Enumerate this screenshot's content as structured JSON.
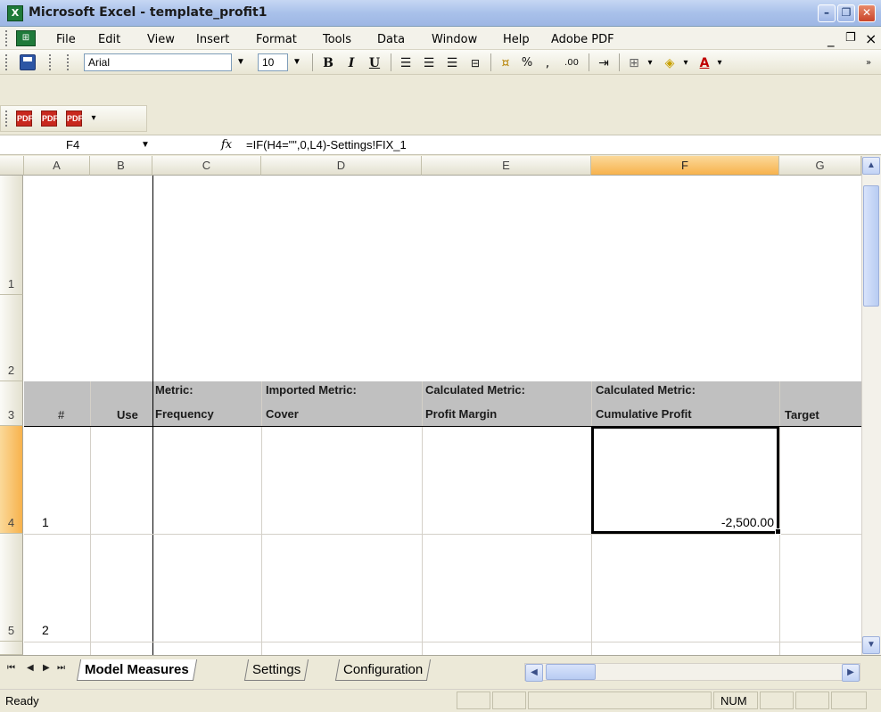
{
  "window": {
    "app_icon_letter": "X",
    "title": "Microsoft Excel - template_profit1",
    "minimize": "–",
    "restore": "❐",
    "close": "✕",
    "doc_min": "_",
    "doc_restore": "❐",
    "doc_close": "×"
  },
  "menu": {
    "items": [
      "File",
      "Edit",
      "View",
      "Insert",
      "Format",
      "Tools",
      "Data",
      "Window",
      "Help",
      "Adobe PDF"
    ]
  },
  "toolbar": {
    "font": "Arial",
    "size": "10",
    "bold": "B",
    "italic": "I",
    "underline": "U",
    "percent": "%",
    "comma": ",",
    "decimal": ".00",
    "font_color_letter": "A"
  },
  "formula": {
    "cell_ref": "F4",
    "fx": "fx",
    "text": "=IF(H4=\"\",0,L4)-Settings!FIX_1"
  },
  "grid": {
    "columns": [
      "A",
      "B",
      "C",
      "D",
      "E",
      "F",
      "G"
    ],
    "selected_column": "F",
    "rows": [
      "1",
      "2",
      "3",
      "4",
      "5"
    ],
    "selected_row": "4",
    "header_row": {
      "a": "#",
      "b": "Use",
      "c_line1": "Metric:",
      "c_line2": "Frequency",
      "d_line1": "Imported Metric:",
      "d_line2": "Cover",
      "e_line1": "Calculated Metric:",
      "e_line2": "Profit Margin",
      "f_line1": "Calculated Metric:",
      "f_line2": "Cumulative Profit",
      "g": "Target"
    },
    "row4": {
      "a": "1",
      "f": "-2,500.00"
    },
    "row5": {
      "a": "2"
    }
  },
  "sheets": {
    "tabs": [
      "Model Measures",
      "Settings",
      "Configuration"
    ],
    "active": "Model Measures"
  },
  "status": {
    "text": "Ready",
    "num": "NUM"
  }
}
